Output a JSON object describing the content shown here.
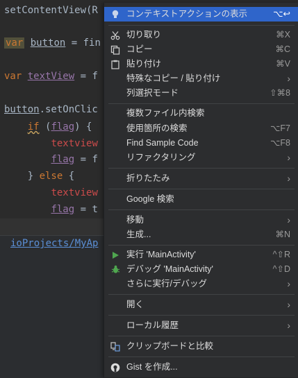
{
  "editor": {
    "lines": [
      {
        "text": "setContentView(R"
      },
      {
        "text": "var button = fin"
      },
      {
        "text": "var textView = f"
      },
      {
        "text": "button.setOnClic"
      },
      {
        "text": "    if (flag) {"
      },
      {
        "text": "        textview"
      },
      {
        "text": "        flag = f"
      },
      {
        "text": "    } else {"
      },
      {
        "text": "        textview"
      },
      {
        "text": "        flag = t"
      }
    ],
    "path_link": "ioProjects/MyAp"
  },
  "menu": {
    "items": [
      {
        "label": "コンテキストアクションの表示",
        "shortcut": "⌥↩",
        "icon": "lightbulb-icon",
        "selected": true
      },
      {
        "label": "切り取り",
        "shortcut": "⌘X",
        "icon": "scissors-icon"
      },
      {
        "label": "コピー",
        "shortcut": "⌘C",
        "icon": "copy-icon"
      },
      {
        "label": "貼り付け",
        "shortcut": "⌘V",
        "icon": "paste-icon"
      },
      {
        "label": "特殊なコピー / 貼り付け",
        "submenu": true
      },
      {
        "label": "列選択モード",
        "shortcut": "⇧⌘8"
      },
      {
        "label": "複数ファイル内検索"
      },
      {
        "label": "使用箇所の検索",
        "shortcut": "⌥F7"
      },
      {
        "label": "Find Sample Code",
        "shortcut": "⌥F8"
      },
      {
        "label": "リファクタリング",
        "submenu": true
      },
      {
        "label": "折りたたみ",
        "submenu": true
      },
      {
        "label": "Google 検索"
      },
      {
        "label": "移動",
        "submenu": true
      },
      {
        "label": "生成...",
        "shortcut": "⌘N"
      },
      {
        "label": "実行 'MainActivity'",
        "shortcut": "^⇧R",
        "icon": "run-icon"
      },
      {
        "label": "デバッグ 'MainActivity'",
        "shortcut": "^⇧D",
        "icon": "debug-icon"
      },
      {
        "label": "さらに実行/デバッグ",
        "submenu": true
      },
      {
        "label": "開く",
        "submenu": true
      },
      {
        "label": "ローカル履歴",
        "submenu": true
      },
      {
        "label": "クリップボードと比較",
        "icon": "compare-icon"
      },
      {
        "label": "Gist を作成...",
        "icon": "github-icon"
      }
    ],
    "submenu_arrow": "›",
    "colors": {
      "selection": "#2f65ca",
      "background": "#2c2d2f",
      "run_green": "#4fa64f"
    }
  }
}
